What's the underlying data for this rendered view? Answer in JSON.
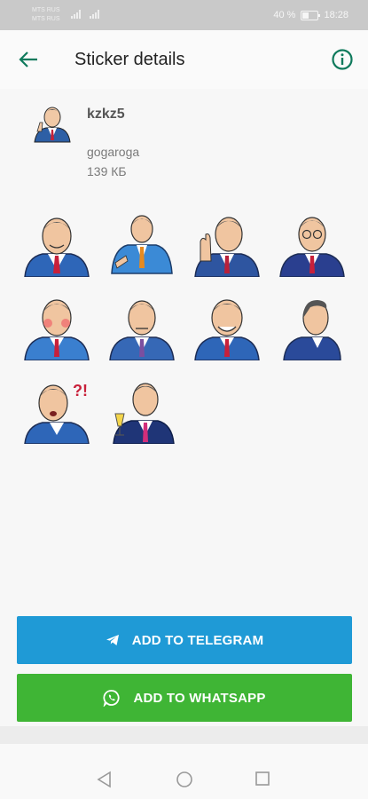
{
  "status_bar": {
    "carrier_1": "MTS RUS",
    "carrier_2": "MTS RUS",
    "battery": "40 %",
    "time": "18:28"
  },
  "app_bar": {
    "title": "Sticker details",
    "back_icon": "arrow-left-icon",
    "info_icon": "info-icon",
    "accent_color": "#0f7a5c"
  },
  "pack": {
    "name": "kzkz5",
    "publisher": "gogaroga",
    "size": "139 КБ"
  },
  "stickers": [
    {
      "id": "sticker-1",
      "pose": "smiling-blue-suit"
    },
    {
      "id": "sticker-2",
      "pose": "sitting-light-blue-suit"
    },
    {
      "id": "sticker-3",
      "pose": "waving-hand"
    },
    {
      "id": "sticker-4",
      "pose": "glasses-reading"
    },
    {
      "id": "sticker-5",
      "pose": "blushing"
    },
    {
      "id": "sticker-6",
      "pose": "serious"
    },
    {
      "id": "sticker-7",
      "pose": "smiling-wide"
    },
    {
      "id": "sticker-8",
      "pose": "profile-side"
    },
    {
      "id": "sticker-9",
      "pose": "surprised-exclamation"
    },
    {
      "id": "sticker-10",
      "pose": "champagne-toast"
    }
  ],
  "actions": {
    "telegram_label": "ADD TO TELEGRAM",
    "whatsapp_label": "ADD TO WHATSAPP",
    "telegram_color": "#1f9ad6",
    "whatsapp_color": "#3fb535"
  },
  "nav": {
    "back_icon": "triangle-back-icon",
    "home_icon": "circle-home-icon",
    "recent_icon": "square-recent-icon"
  }
}
